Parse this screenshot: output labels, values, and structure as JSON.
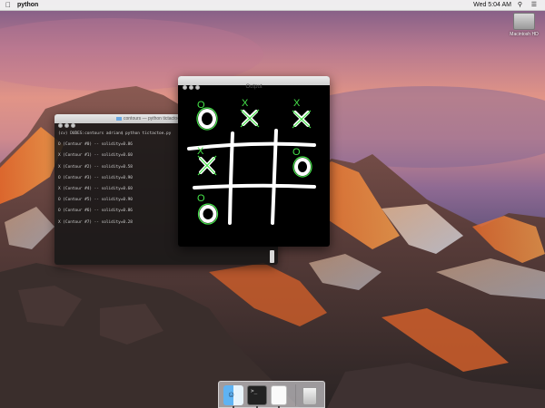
{
  "menubar": {
    "apple_icon": "apple-icon",
    "app_name": "python",
    "clock": "Wed 5:04 AM",
    "search_icon": "magnifier",
    "list_icon": "list"
  },
  "desktop": {
    "disk_label": "Macintosh HD"
  },
  "terminal": {
    "title": "contours — python tictactoe.py",
    "lines": [
      "(cv) DUDES:contours adrian$ python tictactoe.py",
      "O (Contour #0) -- solidity=0.86",
      "X (Contour #1) -- solidity=0.60",
      "X (Contour #2) -- solidity=0.58",
      "O (Contour #3) -- solidity=0.90",
      "X (Contour #4) -- solidity=0.60",
      "O (Contour #5) -- solidity=0.90",
      "O (Contour #6) -- solidity=0.86",
      "X (Contour #7) -- solidity=0.28"
    ]
  },
  "output": {
    "title": "Output",
    "cell_labels": [
      "O",
      "X",
      "X",
      "X",
      "O",
      "O"
    ],
    "label_color": "#46e44a"
  },
  "dock": {
    "items": [
      "finder-icon",
      "terminal-icon",
      "document-icon",
      "trash-icon"
    ],
    "terminal_prompt": ">_"
  }
}
